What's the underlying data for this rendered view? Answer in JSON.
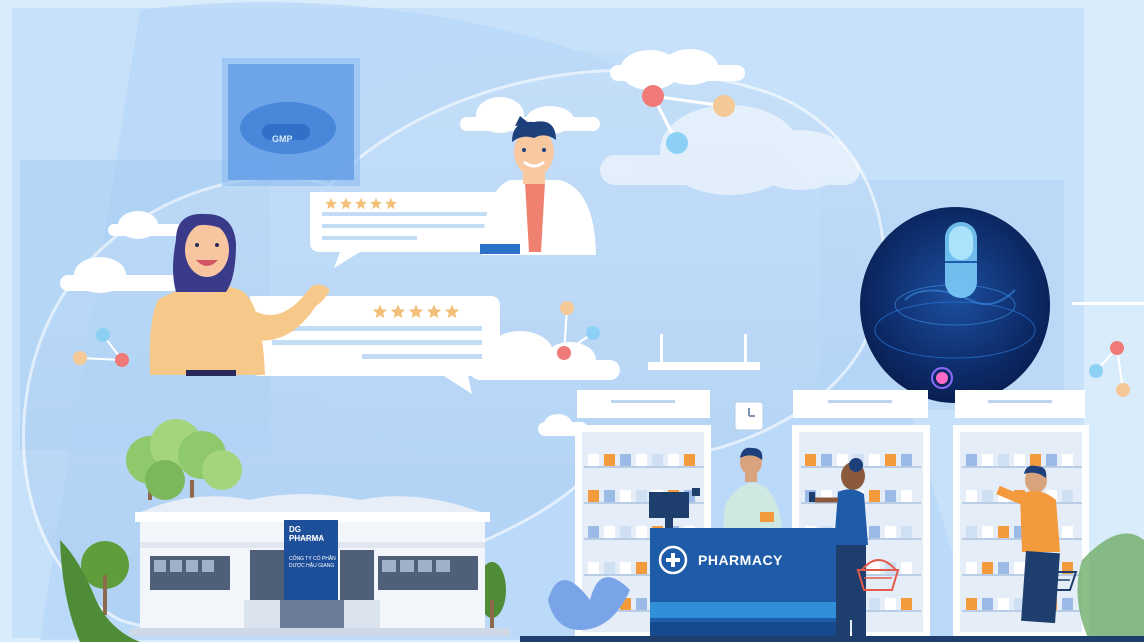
{
  "pharmacy": {
    "counter_label": "PHARMACY"
  },
  "building": {
    "sign_title": "DG PHARMA",
    "sign_subtitle": "IT HỒ ANH HẬU GIANG",
    "sign_company": "CÔNG TY CỔ PHẦN DƯỢC HẬU GIANG"
  },
  "certificate": {
    "label": "GMP"
  },
  "reviews": [
    {
      "rating_stars": 5
    },
    {
      "rating_stars": 5
    }
  ],
  "colors": {
    "sky": "#d9ecfb",
    "brand_blue": "#1e5ba8",
    "counter_stripe": "#2f8fd8",
    "star": "#f2c07a",
    "orange": "#f39a3c"
  }
}
